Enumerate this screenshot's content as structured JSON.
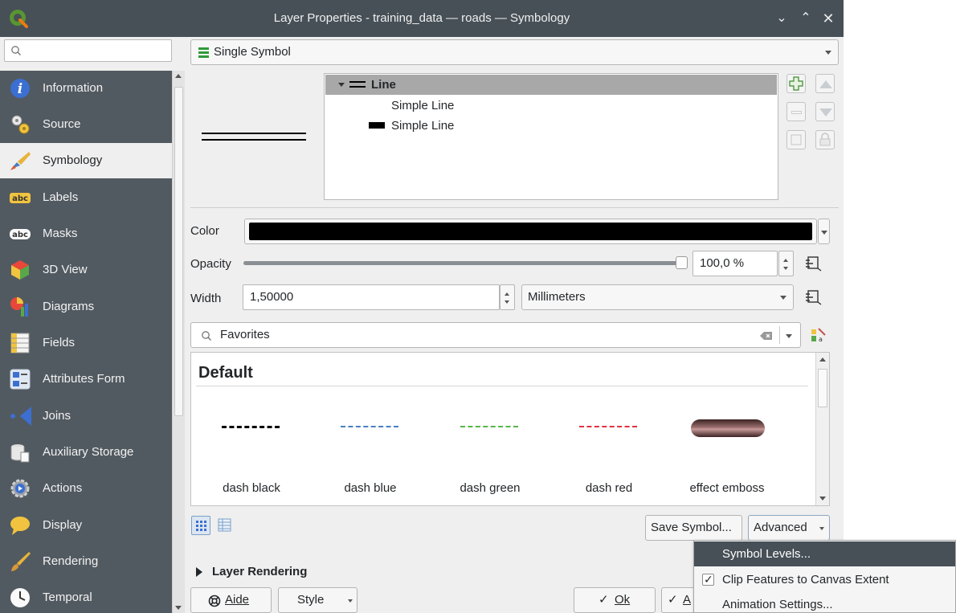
{
  "window": {
    "title": "Layer Properties - training_data — roads — Symbology"
  },
  "sidebar": {
    "search_placeholder": "",
    "items": [
      {
        "label": "Information",
        "icon": "info-icon"
      },
      {
        "label": "Source",
        "icon": "source-icon"
      },
      {
        "label": "Symbology",
        "icon": "symbology-brush-icon",
        "active": true
      },
      {
        "label": "Labels",
        "icon": "labels-abc-icon"
      },
      {
        "label": "Masks",
        "icon": "masks-abc-icon"
      },
      {
        "label": "3D View",
        "icon": "cube-3d-icon"
      },
      {
        "label": "Diagrams",
        "icon": "diagrams-icon"
      },
      {
        "label": "Fields",
        "icon": "fields-icon"
      },
      {
        "label": "Attributes Form",
        "icon": "attributes-form-icon"
      },
      {
        "label": "Joins",
        "icon": "joins-icon"
      },
      {
        "label": "Auxiliary Storage",
        "icon": "auxiliary-storage-icon"
      },
      {
        "label": "Actions",
        "icon": "actions-gear-icon"
      },
      {
        "label": "Display",
        "icon": "display-speech-bubble-icon"
      },
      {
        "label": "Rendering",
        "icon": "rendering-brush-icon"
      },
      {
        "label": "Temporal",
        "icon": "temporal-clock-icon"
      }
    ]
  },
  "renderer": {
    "selected": "Single Symbol"
  },
  "symbol_tree": {
    "root": "Line",
    "layers": [
      "Simple Line",
      "Simple Line"
    ]
  },
  "properties": {
    "color_label": "Color",
    "color_value": "#000000",
    "opacity_label": "Opacity",
    "opacity_value": "100,0 %",
    "opacity_fraction": 1.0,
    "width_label": "Width",
    "width_value": "1,50000",
    "unit": "Millimeters"
  },
  "library": {
    "filter": "Favorites",
    "group": "Default",
    "symbols": [
      {
        "label": "dash  black",
        "color": "#000000"
      },
      {
        "label": "dash blue",
        "color": "#4a7fc0"
      },
      {
        "label": "dash green",
        "color": "#55b848"
      },
      {
        "label": "dash red",
        "color": "#e0323c"
      },
      {
        "label": "effect emboss",
        "color": "#8a5a5a"
      }
    ],
    "save_button": "Save Symbol...",
    "advanced_button": "Advanced"
  },
  "layer_rendering": {
    "label": "Layer Rendering"
  },
  "footer": {
    "help_button": "Aide",
    "style_button": "Style",
    "ok_button": "Ok",
    "apply_button": "A"
  },
  "advanced_menu": {
    "items": [
      {
        "label": "Symbol Levels...",
        "checked": false,
        "highlighted": true
      },
      {
        "label": "Clip Features to Canvas Extent",
        "checked": true,
        "highlighted": false
      },
      {
        "label": "Animation Settings...",
        "checked": false,
        "highlighted": false
      }
    ]
  }
}
